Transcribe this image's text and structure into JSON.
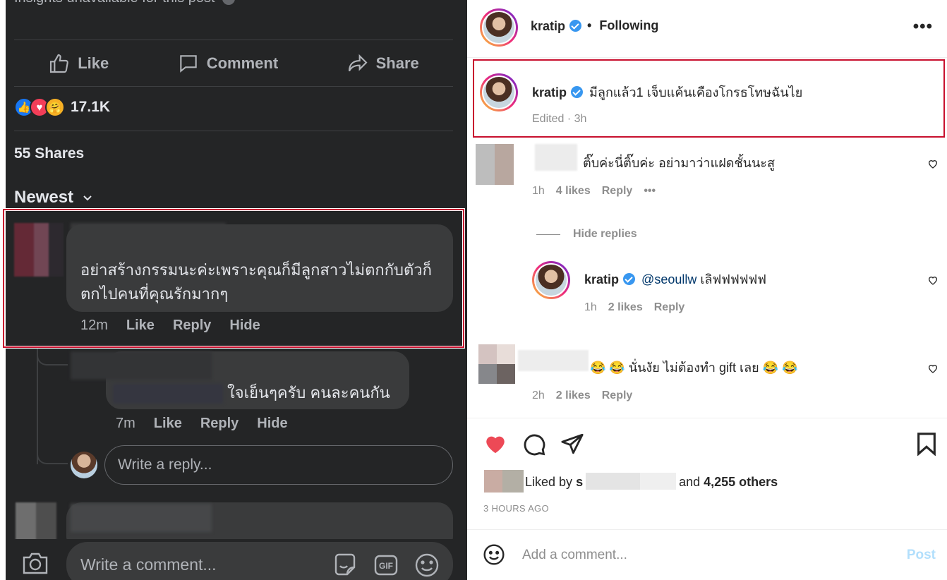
{
  "facebook": {
    "insights_text": "Insights unavailable for this post",
    "actions": {
      "like": "Like",
      "comment": "Comment",
      "share": "Share"
    },
    "reaction_count": "17.1K",
    "shares": "55 Shares",
    "sort_label": "Newest",
    "highlighted_comment": {
      "text_line1": "อย่าสร้างกรรมนะค่ะเพราะคุณก็มีลูกสาวไม่ตกกับตัวก็",
      "text_line2": "ตกไปคนที่คุณรักมากๆ",
      "time": "12m",
      "like": "Like",
      "reply": "Reply",
      "hide": "Hide"
    },
    "reply_comment": {
      "text": "ใจเย็นๆครับ คนละคนกัน",
      "time": "7m",
      "like": "Like",
      "reply": "Reply",
      "hide": "Hide"
    },
    "reply_placeholder": "Write a reply...",
    "comment_placeholder": "Write a comment...",
    "gif_label": "GIF"
  },
  "instagram": {
    "header": {
      "username": "kratip",
      "separator": "•",
      "following": "Following",
      "more": "•••"
    },
    "caption": {
      "username": "kratip",
      "text": "มีลูกแล้ว1 เจ็บแค้นเคืองโกรธโทษฉันไย",
      "meta": "Edited · 3h"
    },
    "comments": [
      {
        "text": "ติ๊บค่ะนี่ติ๊บค่ะ อย่ามาว่าแฝดชั้นนะสู",
        "time": "1h",
        "likes": "4 likes",
        "reply": "Reply",
        "more": "•••"
      },
      {
        "text": "😂 😂  นั่นงัย ไม่ต้องทำ gift เลย  😂 😂",
        "time": "2h",
        "likes": "2 likes",
        "reply": "Reply"
      }
    ],
    "hide_replies": "Hide replies",
    "reply": {
      "username": "kratip",
      "mention": "@seoullw",
      "text": "เลิฟฟฟฟฟฟ",
      "time": "1h",
      "likes": "2 likes",
      "reply": "Reply"
    },
    "liked_by_prefix": "Liked by",
    "liked_by_first": "s",
    "liked_by_and": "and",
    "liked_by_others": "4,255 others",
    "time_ago": "3 HOURS AGO",
    "add_comment_placeholder": "Add a comment...",
    "post_label": "Post",
    "colors": {
      "heart": "#ed4956",
      "verified": "#3897f0",
      "frame": "#c8102e"
    }
  }
}
